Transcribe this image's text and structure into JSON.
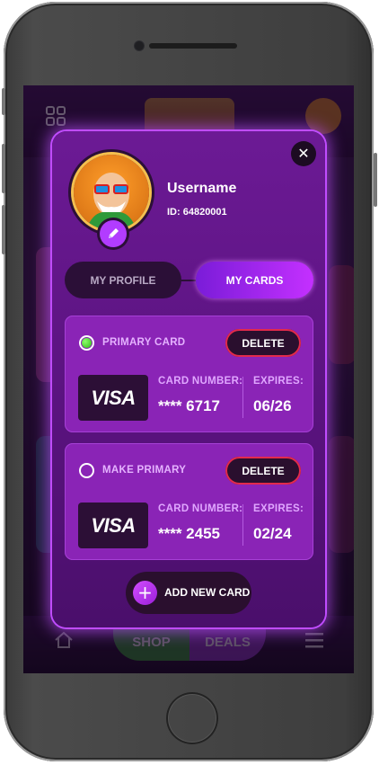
{
  "profile": {
    "username": "Username",
    "id_text": "ID: 64820001"
  },
  "tabs": [
    {
      "label": "MY PROFILE",
      "active": false
    },
    {
      "label": "MY CARDS",
      "active": true
    }
  ],
  "cards": [
    {
      "status_label": "PRIMARY CARD",
      "is_primary": true,
      "delete_label": "DELETE",
      "brand": "VISA",
      "number_label": "CARD NUMBER:",
      "number": "**** 6717",
      "expires_label": "EXPIRES:",
      "expires": "06/26"
    },
    {
      "status_label": "MAKE PRIMARY",
      "is_primary": false,
      "delete_label": "DELETE",
      "brand": "VISA",
      "number_label": "CARD NUMBER:",
      "number": "**** 2455",
      "expires_label": "EXPIRES:",
      "expires": "02/24"
    }
  ],
  "add_card": {
    "label": "ADD NEW CARD",
    "icon": "plus-icon"
  },
  "background": {
    "nav_shop": "SHOP",
    "nav_deals": "DEALS"
  },
  "icons": {
    "close": "close-icon",
    "edit": "pencil-icon",
    "radio_selected": "radio-selected-icon",
    "radio_empty": "radio-empty-icon"
  },
  "colors": {
    "modal": "#5a137f",
    "accent": "#c430ff",
    "delete_border": "#e22a4c",
    "primary_dot": "#2fb814"
  }
}
